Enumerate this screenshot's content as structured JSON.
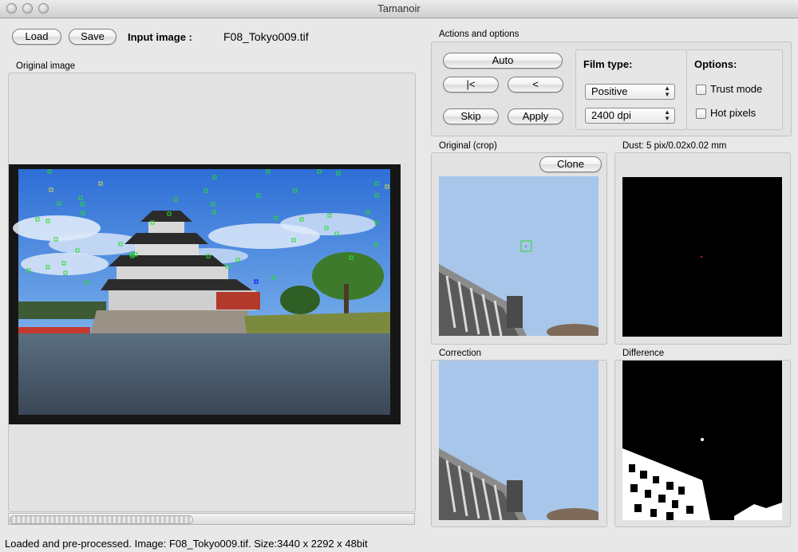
{
  "window": {
    "title": "Tamanoir"
  },
  "toolbar": {
    "load_label": "Load",
    "save_label": "Save",
    "input_image_label": "Input image :",
    "input_image_value": "F08_Tokyo009.tif"
  },
  "original_image": {
    "title": "Original image"
  },
  "actions": {
    "title": "Actions and options",
    "auto_label": "Auto",
    "first_label": "|<",
    "prev_label": "<",
    "skip_label": "Skip",
    "apply_label": "Apply"
  },
  "film_type": {
    "title": "Film type:",
    "type_value": "Positive",
    "dpi_value": "2400 dpi"
  },
  "options": {
    "title": "Options:",
    "trust_mode_label": "Trust mode",
    "trust_mode_checked": false,
    "hot_pixels_label": "Hot pixels",
    "hot_pixels_checked": false
  },
  "crop": {
    "title": "Original (crop)",
    "clone_label": "Clone"
  },
  "dust": {
    "title": "Dust: 5 pix/0.02x0.02 mm"
  },
  "correction": {
    "title": "Correction"
  },
  "difference": {
    "title": "Difference"
  },
  "status": {
    "text": "Loaded and pre-processed. Image: F08_Tokyo009.tif. Size:3440 x 2292 x 48bit"
  },
  "colors": {
    "dust_marker": "#2bd92b",
    "selected_marker": "#0000ff",
    "highlight_marker": "#d9d94a"
  }
}
